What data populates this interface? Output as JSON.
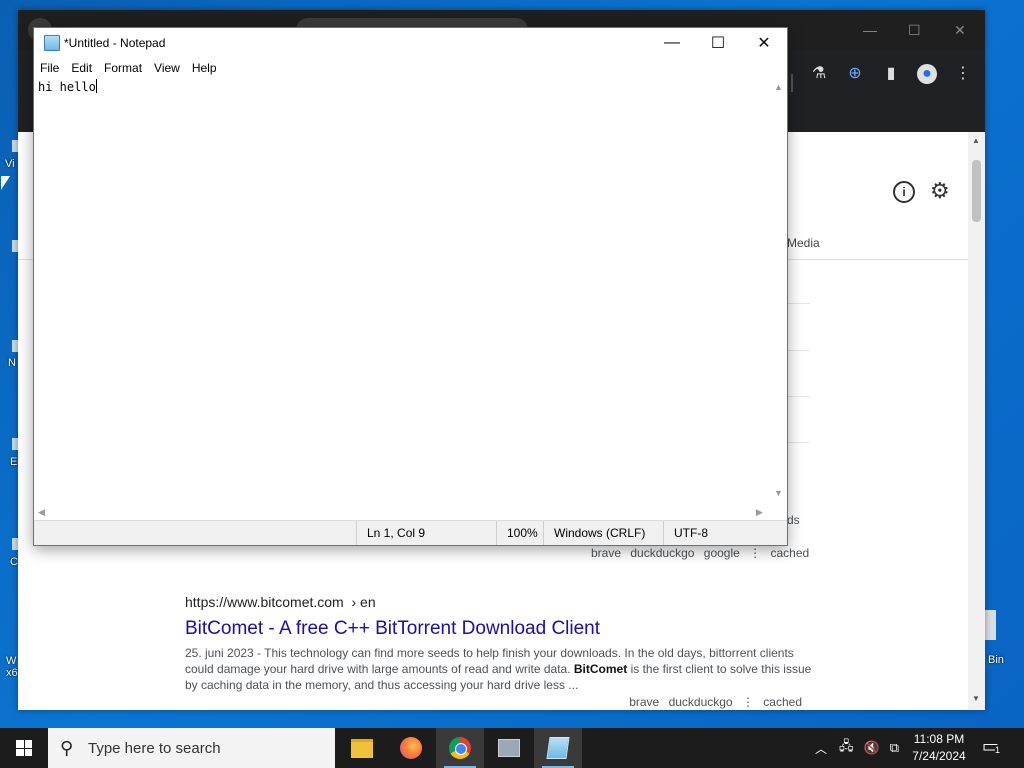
{
  "notepad": {
    "title": "*Untitled - Notepad",
    "menu": [
      "File",
      "Edit",
      "Format",
      "View",
      "Help"
    ],
    "content": "hi hello",
    "status": {
      "position": "Ln 1, Col 9",
      "zoom": "100%",
      "line_ending": "Windows (CRLF)",
      "encoding": "UTF-8"
    }
  },
  "browser": {
    "tab_label": "Media",
    "peek_text": "ds",
    "result_prev_links": {
      "brave": "brave",
      "duckduckgo": "duckduckgo",
      "google": "google",
      "cached": "cached"
    },
    "result": {
      "url": "https://www.bitcomet.com",
      "url_suffix": "› en",
      "title": "BitComet - A free C++ BitTorrent Download Client",
      "desc_pre": "25. juni 2023 - This technology can find more seeds to help finish your downloads. In the old days, bittorrent clients could damage your hard drive with large amounts of read and write data. ",
      "desc_bold": "BitComet",
      "desc_post": " is the first client to solve this issue by caching data in the memory, and thus accessing your hard drive less ...",
      "links": {
        "brave": "brave",
        "duckduckgo": "duckduckgo",
        "cached": "cached"
      }
    }
  },
  "desktop": {
    "bin_label": "Bin"
  },
  "taskbar": {
    "search_placeholder": "Type here to search",
    "time": "11:08 PM",
    "date": "7/24/2024",
    "notification_count": "1"
  }
}
